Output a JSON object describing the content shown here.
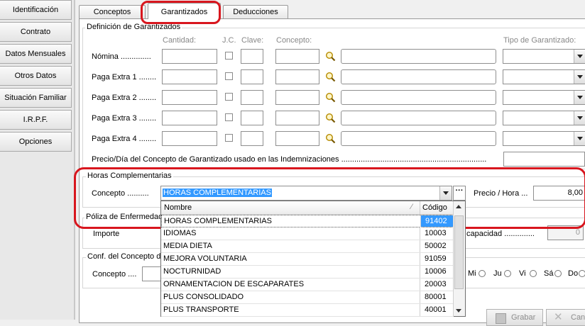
{
  "nav": {
    "items": [
      "Identificación",
      "Contrato",
      "Datos Mensuales",
      "Otros Datos",
      "Situación Familiar",
      "I.R.P.F.",
      "Opciones"
    ]
  },
  "tabs": [
    "Conceptos",
    "Garantizados",
    "Deducciones"
  ],
  "garantizados": {
    "title": "Definición de Garantizados",
    "headers": {
      "cantidad": "Cantidad:",
      "jc": "J.C.",
      "clave": "Clave:",
      "concepto": "Concepto:",
      "tipo": "Tipo de Garantizado:"
    },
    "rows": [
      "Nómina ..............",
      "Paga Extra 1 ........",
      "Paga Extra 2 ........",
      "Paga Extra 3 ........",
      "Paga Extra 4 ........"
    ],
    "precio_label": "Precio/Día del Concepto de Garantizado usado en las Indemnizaciones ..................................................................."
  },
  "horas": {
    "title": "Horas Complementarias",
    "concepto_label": "Concepto ..........",
    "concepto_value": "HORAS COMPLEMENTARIAS",
    "precio_label": "Precio / Hora ...",
    "precio_value": "8,00"
  },
  "poliza": {
    "title": "Póliza de Enfermedad",
    "importe_label": "Importe",
    "capacidad_label": "capacidad ..............",
    "capacidad_value": "0"
  },
  "conf": {
    "title": "Conf. del Concepto d",
    "concepto_label": "Concepto ....",
    "days": [
      "Mi",
      "Ju",
      "Vi",
      "Sá",
      "Do"
    ]
  },
  "dropdown": {
    "col_nombre": "Nombre",
    "col_codigo": "Código",
    "rows": [
      {
        "nombre": "HORAS COMPLEMENTARIAS",
        "codigo": "91402"
      },
      {
        "nombre": "IDIOMAS",
        "codigo": "10003"
      },
      {
        "nombre": "MEDIA DIETA",
        "codigo": "50002"
      },
      {
        "nombre": "MEJORA VOLUNTARIA",
        "codigo": "91059"
      },
      {
        "nombre": "NOCTURNIDAD",
        "codigo": "10006"
      },
      {
        "nombre": "ORNAMENTACION DE ESCAPARATES",
        "codigo": "20003"
      },
      {
        "nombre": "PLUS CONSOLIDADO",
        "codigo": "80001"
      },
      {
        "nombre": "PLUS TRANSPORTE",
        "codigo": "40001"
      }
    ]
  },
  "buttons": {
    "grabar": "Grabar",
    "cancelar": "Cance"
  },
  "colors": {
    "highlight": "#3399ff",
    "annotation_red": "#d8161e"
  }
}
